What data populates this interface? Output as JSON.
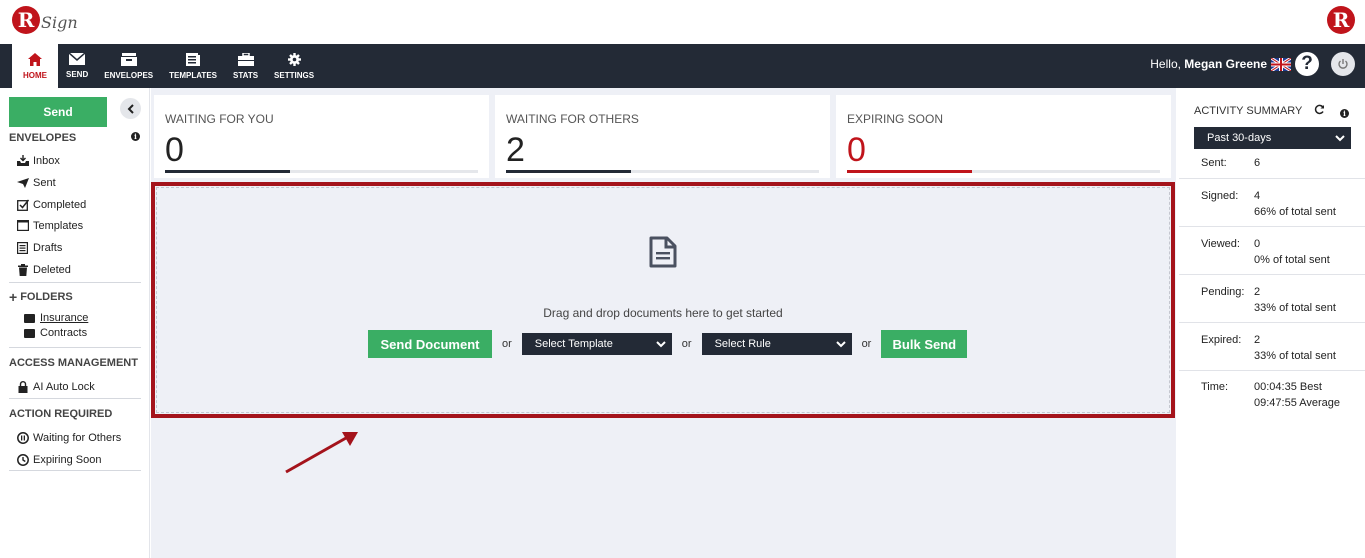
{
  "brand": {
    "logo_letter": "R",
    "logo_script": "Sign"
  },
  "nav": {
    "items": [
      {
        "label": "HOME",
        "icon": "home-icon",
        "active": true
      },
      {
        "label": "SEND",
        "icon": "envelope-icon"
      },
      {
        "label": "ENVELOPES",
        "icon": "inbox-icon"
      },
      {
        "label": "TEMPLATES",
        "icon": "templates-icon"
      },
      {
        "label": "STATS",
        "icon": "briefcase-icon"
      },
      {
        "label": "SETTINGS",
        "icon": "gear-icon"
      }
    ],
    "hello_prefix": "Hello,",
    "user_name": "Megan Greene",
    "help_label": "?",
    "power_icon": "power-icon"
  },
  "sidebar": {
    "send_label": "Send",
    "collapse_icon": "chevron-left-icon",
    "envelopes_heading": "ENVELOPES",
    "envelopes": [
      {
        "label": "Inbox",
        "icon": "inbox-tray-icon"
      },
      {
        "label": "Sent",
        "icon": "paper-plane-icon"
      },
      {
        "label": "Completed",
        "icon": "check-square-icon"
      },
      {
        "label": "Templates",
        "icon": "template-icon"
      },
      {
        "label": "Drafts",
        "icon": "drafts-icon"
      },
      {
        "label": "Deleted",
        "icon": "trash-icon"
      }
    ],
    "folders_heading": "FOLDERS",
    "folders": [
      {
        "label": "Insurance"
      },
      {
        "label": "Contracts"
      }
    ],
    "access_heading": "ACCESS MANAGEMENT",
    "access_items": [
      {
        "label": "AI Auto Lock",
        "icon": "lock-icon"
      }
    ],
    "action_heading": "ACTION REQUIRED",
    "action_items": [
      {
        "label": "Waiting for Others",
        "icon": "pause-circle-icon"
      },
      {
        "label": "Expiring Soon",
        "icon": "clock-icon"
      }
    ]
  },
  "stats": [
    {
      "label": "WAITING FOR YOU",
      "value": "0",
      "progress": 0.4,
      "color": "#232a36"
    },
    {
      "label": "WAITING FOR OTHERS",
      "value": "2",
      "progress": 0.4,
      "color": "#232a36"
    },
    {
      "label": "EXPIRING SOON",
      "value": "0",
      "progress": 0.4,
      "color": "#c0141b"
    }
  ],
  "dropzone": {
    "icon": "document-icon",
    "text": "Drag and drop documents here to get started",
    "send_document_label": "Send Document",
    "or": "or",
    "select_template": "Select Template",
    "select_rule": "Select Rule",
    "bulk_send_label": "Bulk Send"
  },
  "activity": {
    "title": "ACTIVITY SUMMARY",
    "period": "Past 30-days",
    "rows": [
      {
        "key": "Sent:",
        "v1": "6",
        "v2": ""
      },
      {
        "key": "Signed:",
        "v1": "4",
        "v2": "66% of total sent"
      },
      {
        "key": "Viewed:",
        "v1": "0",
        "v2": "0% of total sent"
      },
      {
        "key": "Pending:",
        "v1": "2",
        "v2": "33% of total sent"
      },
      {
        "key": "Expired:",
        "v1": "2",
        "v2": "33% of total sent"
      },
      {
        "key": "Time:",
        "v1": "00:04:35 Best",
        "v2": "09:47:55 Average"
      }
    ]
  },
  "colors": {
    "accent_green": "#3aae64",
    "nav_dark": "#232a36",
    "brand_red": "#c0141b",
    "highlight_border": "#a4131b"
  }
}
